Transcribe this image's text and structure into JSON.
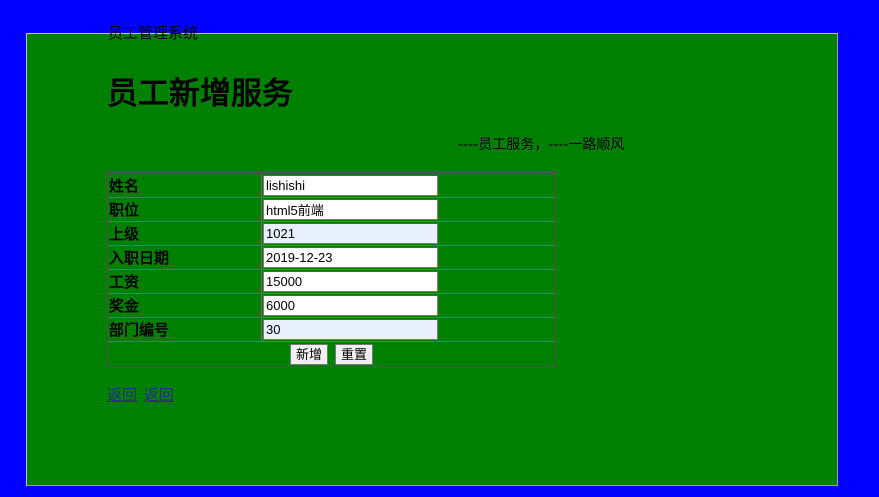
{
  "header": {
    "site_title": "员工管理系统",
    "heading": "员工新增服务",
    "subtitle": "----员工服务，----一路顺风"
  },
  "form": {
    "rows": [
      {
        "label": "姓名",
        "value": "lishishi"
      },
      {
        "label": "职位",
        "value": "html5前端"
      },
      {
        "label": "上级",
        "value": "1021"
      },
      {
        "label": "入职日期",
        "value": "2019-12-23"
      },
      {
        "label": "工资",
        "value": "15000"
      },
      {
        "label": "奖金",
        "value": "6000"
      },
      {
        "label": "部门编号",
        "value": "30"
      }
    ],
    "submit_label": "新增",
    "reset_label": "重置"
  },
  "links": {
    "back1": "返回",
    "back2": "返回"
  },
  "colors": {
    "page_background": "#0000ff",
    "panel_background": "#008000",
    "autofill_background": "#e8f0fe"
  }
}
